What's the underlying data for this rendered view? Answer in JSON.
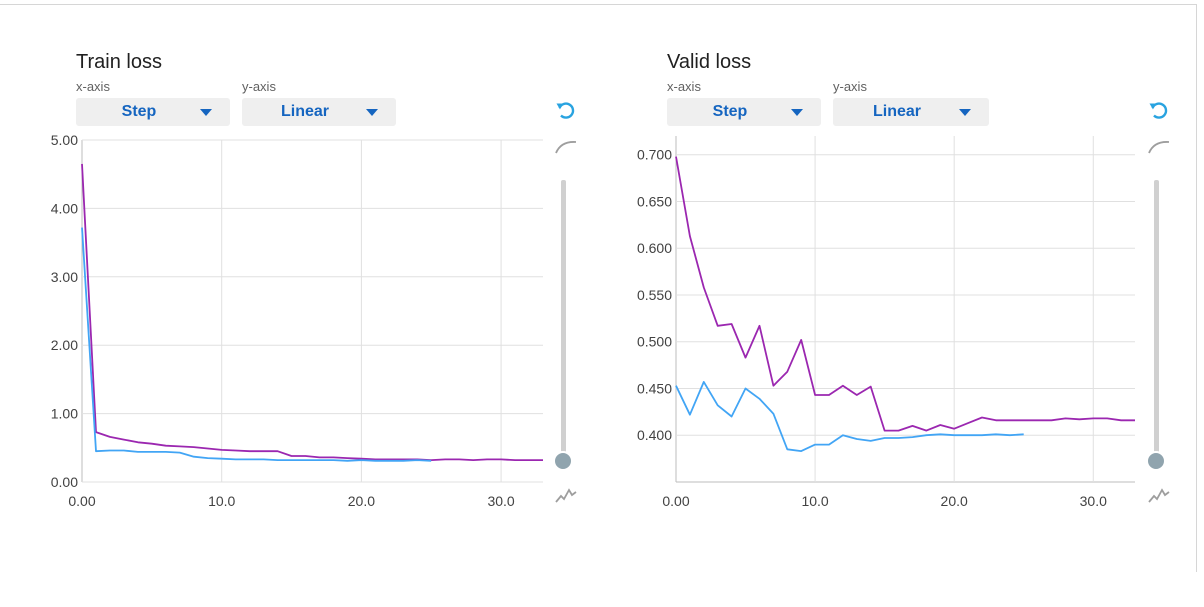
{
  "cards": [
    {
      "title": "Train loss",
      "x_axis_label": "x-axis",
      "x_axis_value": "Step",
      "y_axis_label": "y-axis",
      "y_axis_value": "Linear",
      "icons": [
        "reset-icon",
        "smooth-curve-icon",
        "raw-line-icon"
      ],
      "smoothing_slider": 0.0
    },
    {
      "title": "Valid loss",
      "x_axis_label": "x-axis",
      "x_axis_value": "Step",
      "y_axis_label": "y-axis",
      "y_axis_value": "Linear",
      "icons": [
        "reset-icon",
        "smooth-curve-icon",
        "raw-line-icon"
      ],
      "smoothing_slider": 0.0
    }
  ],
  "colors": {
    "series_purple": "#9b27b0",
    "series_blue": "#42a5f5",
    "accent": "#1565c0"
  },
  "chart_data": [
    {
      "type": "line",
      "title": "Train loss",
      "xlim": [
        0,
        33
      ],
      "ylim": [
        0,
        5
      ],
      "grid": true,
      "x_ticks": [
        "0.00",
        "10.0",
        "20.0",
        "30.0"
      ],
      "y_ticks": [
        "0.00",
        "1.00",
        "2.00",
        "3.00",
        "4.00",
        "5.00"
      ],
      "series": [
        {
          "color": "#9b27b0",
          "x": [
            0,
            1,
            2,
            3,
            4,
            5,
            6,
            7,
            8,
            9,
            10,
            11,
            12,
            13,
            14,
            15,
            16,
            17,
            18,
            19,
            20,
            21,
            22,
            23,
            24,
            25,
            26,
            27,
            28,
            29,
            30,
            31,
            32,
            33
          ],
          "y": [
            4.65,
            0.73,
            0.66,
            0.62,
            0.58,
            0.56,
            0.53,
            0.52,
            0.51,
            0.49,
            0.47,
            0.46,
            0.45,
            0.45,
            0.45,
            0.38,
            0.38,
            0.36,
            0.36,
            0.35,
            0.34,
            0.33,
            0.33,
            0.33,
            0.33,
            0.32,
            0.33,
            0.33,
            0.32,
            0.33,
            0.33,
            0.32,
            0.32,
            0.32
          ]
        },
        {
          "color": "#42a5f5",
          "x": [
            0,
            1,
            2,
            3,
            4,
            5,
            6,
            7,
            8,
            9,
            10,
            11,
            12,
            13,
            14,
            15,
            16,
            17,
            18,
            19,
            20,
            21,
            22,
            23,
            24,
            25
          ],
          "y": [
            3.72,
            0.45,
            0.46,
            0.46,
            0.44,
            0.44,
            0.44,
            0.43,
            0.37,
            0.35,
            0.34,
            0.33,
            0.33,
            0.33,
            0.32,
            0.32,
            0.32,
            0.32,
            0.32,
            0.31,
            0.32,
            0.31,
            0.31,
            0.31,
            0.32,
            0.31
          ]
        }
      ]
    },
    {
      "type": "line",
      "title": "Valid loss",
      "xlim": [
        0,
        33
      ],
      "ylim": [
        0.35,
        0.72
      ],
      "grid": true,
      "x_ticks": [
        "0.00",
        "10.0",
        "20.0",
        "30.0"
      ],
      "y_ticks": [
        "0.400",
        "0.450",
        "0.500",
        "0.550",
        "0.600",
        "0.650",
        "0.700"
      ],
      "series": [
        {
          "color": "#9b27b0",
          "x": [
            0,
            1,
            2,
            3,
            4,
            5,
            6,
            7,
            8,
            9,
            10,
            11,
            12,
            13,
            14,
            15,
            16,
            17,
            18,
            19,
            20,
            21,
            22,
            23,
            24,
            25,
            26,
            27,
            28,
            29,
            30,
            31,
            32,
            33
          ],
          "y": [
            0.698,
            0.613,
            0.558,
            0.517,
            0.519,
            0.483,
            0.517,
            0.453,
            0.468,
            0.502,
            0.443,
            0.443,
            0.453,
            0.443,
            0.452,
            0.405,
            0.405,
            0.41,
            0.405,
            0.411,
            0.407,
            0.413,
            0.419,
            0.416,
            0.416,
            0.416,
            0.416,
            0.416,
            0.418,
            0.417,
            0.418,
            0.418,
            0.416,
            0.416
          ]
        },
        {
          "color": "#42a5f5",
          "x": [
            0,
            1,
            2,
            3,
            4,
            5,
            6,
            7,
            8,
            9,
            10,
            11,
            12,
            13,
            14,
            15,
            16,
            17,
            18,
            19,
            20,
            21,
            22,
            23,
            24,
            25
          ],
          "y": [
            0.453,
            0.422,
            0.457,
            0.432,
            0.42,
            0.45,
            0.439,
            0.423,
            0.385,
            0.383,
            0.39,
            0.39,
            0.4,
            0.396,
            0.394,
            0.397,
            0.397,
            0.398,
            0.4,
            0.401,
            0.4,
            0.4,
            0.4,
            0.401,
            0.4,
            0.401
          ]
        }
      ]
    }
  ]
}
